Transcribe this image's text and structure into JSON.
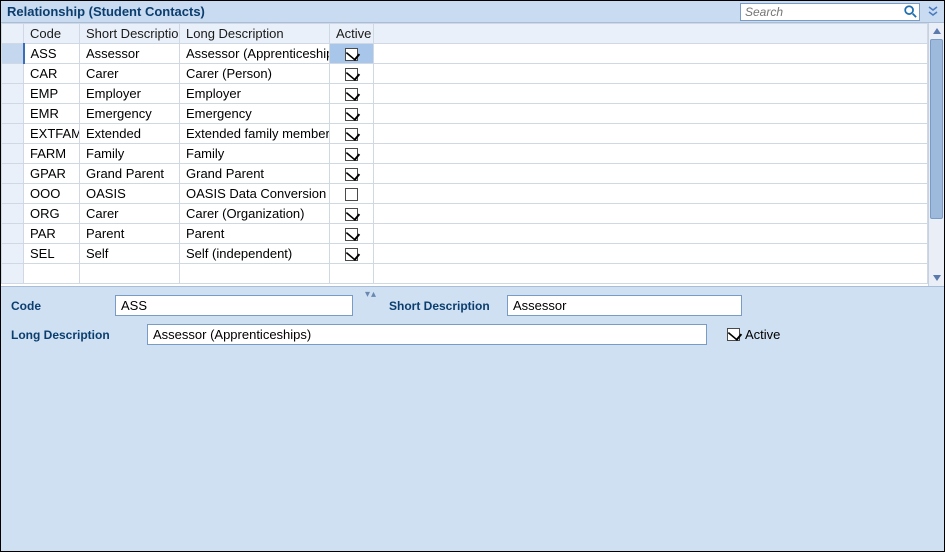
{
  "title": "Relationship (Student Contacts)",
  "search": {
    "placeholder": "Search"
  },
  "columns": {
    "code": "Code",
    "short": "Short Description",
    "long": "Long Description",
    "active": "Active"
  },
  "rows": [
    {
      "code": "ASS",
      "short": "Assessor",
      "long": "Assessor (Apprenticeships)",
      "active": true,
      "selected": true
    },
    {
      "code": "CAR",
      "short": "Carer",
      "long": "Carer (Person)",
      "active": true,
      "selected": false
    },
    {
      "code": "EMP",
      "short": "Employer",
      "long": "Employer",
      "active": true,
      "selected": false
    },
    {
      "code": "EMR",
      "short": "Emergency",
      "long": "Emergency",
      "active": true,
      "selected": false
    },
    {
      "code": "EXTFAM",
      "short": "Extended",
      "long": "Extended family member",
      "active": true,
      "selected": false
    },
    {
      "code": "FARM",
      "short": "Family",
      "long": "Family",
      "active": true,
      "selected": false
    },
    {
      "code": "GPAR",
      "short": "Grand Parent",
      "long": "Grand Parent",
      "active": true,
      "selected": false
    },
    {
      "code": "OOO",
      "short": "OASIS",
      "long": "OASIS Data Conversion",
      "active": false,
      "selected": false
    },
    {
      "code": "ORG",
      "short": "Carer",
      "long": "Carer (Organization)",
      "active": true,
      "selected": false
    },
    {
      "code": "PAR",
      "short": "Parent",
      "long": "Parent",
      "active": true,
      "selected": false
    },
    {
      "code": "SEL",
      "short": "Self",
      "long": "Self (independent)",
      "active": true,
      "selected": false
    }
  ],
  "partial_row": {
    "code": "",
    "short": "",
    "long": ""
  },
  "form": {
    "labels": {
      "code": "Code",
      "short": "Short Description",
      "long": "Long Description",
      "active": "Active"
    },
    "values": {
      "code": "ASS",
      "short": "Assessor",
      "long": "Assessor (Apprenticeships)",
      "active": true
    }
  }
}
